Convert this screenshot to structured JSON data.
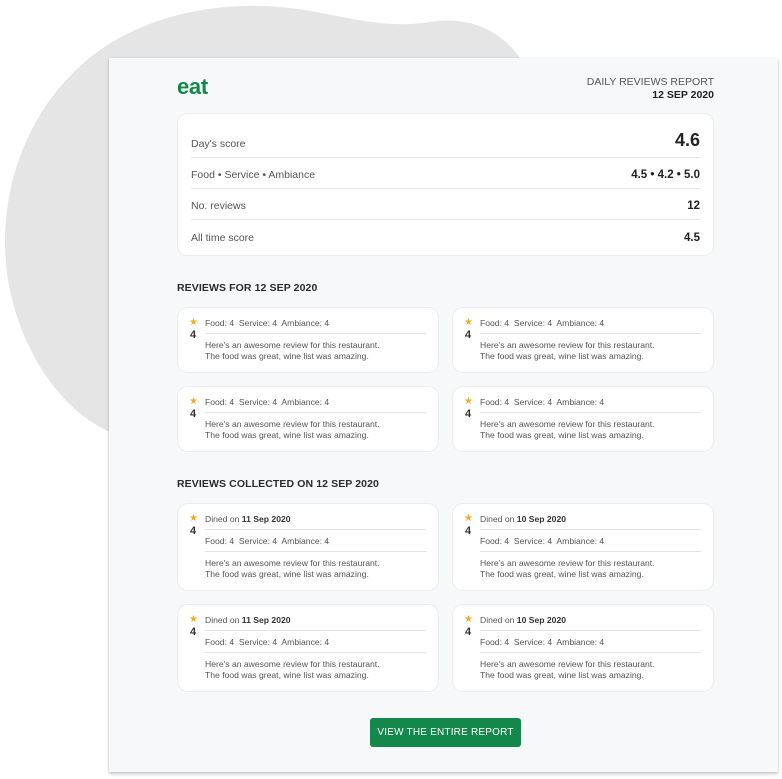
{
  "brand": {
    "logo": "eat",
    "accent_color": "#14884a"
  },
  "report": {
    "title": "DAILY REVIEWS REPORT",
    "date": "12 SEP 2020"
  },
  "summary": [
    {
      "label": "Day's score",
      "value": "4.6"
    },
    {
      "label": "Food • Service • Ambiance",
      "value": "4.5 • 4.2 • 5.0"
    },
    {
      "label": "No. reviews",
      "value": "12"
    },
    {
      "label": "All time score",
      "value": "4.5"
    }
  ],
  "reviews_section": {
    "title": "REVIEWS FOR 12 SEP 2020",
    "items": [
      {
        "rating": "4",
        "scores": "Food: 4  Service: 4  Ambiance: 4",
        "text_line1": "Here's an awesome review for this restaurant.",
        "text_line2": "The food was great, wine list was amazing."
      },
      {
        "rating": "4",
        "scores": "Food: 4  Service: 4  Ambiance: 4",
        "text_line1": "Here's an awesome review for this restaurant.",
        "text_line2": "The food was great, wine list was amazing."
      },
      {
        "rating": "4",
        "scores": "Food: 4  Service: 4  Ambiance: 4",
        "text_line1": "Here's an awesome review for this restaurant.",
        "text_line2": "The food was great, wine list was amazing."
      },
      {
        "rating": "4",
        "scores": "Food: 4  Service: 4  Ambiance: 4",
        "text_line1": "Here's an awesome review for this restaurant.",
        "text_line2": "The food was great, wine list was amazing."
      }
    ]
  },
  "collected_section": {
    "title": "REVIEWS COLLECTED ON 12 SEP 2020",
    "dined_prefix": "Dined on ",
    "items": [
      {
        "rating": "4",
        "dined_date": "11 Sep 2020",
        "scores": "Food: 4  Service: 4  Ambiance: 4",
        "text_line1": "Here's an awesome review for this restaurant.",
        "text_line2": "The food was great, wine list was amazing."
      },
      {
        "rating": "4",
        "dined_date": "10 Sep 2020",
        "scores": "Food: 4  Service: 4  Ambiance: 4",
        "text_line1": "Here's an awesome review for this restaurant.",
        "text_line2": "The food was great, wine list was amazing."
      },
      {
        "rating": "4",
        "dined_date": "11 Sep 2020",
        "scores": "Food: 4  Service: 4  Ambiance: 4",
        "text_line1": "Here's an awesome review for this restaurant.",
        "text_line2": "The food was great, wine list was amazing."
      },
      {
        "rating": "4",
        "dined_date": "10 Sep 2020",
        "scores": "Food: 4  Service: 4  Ambiance: 4",
        "text_line1": "Here's an awesome review for this restaurant.",
        "text_line2": "The food was great, wine list was amazing."
      }
    ]
  },
  "cta": {
    "label": "VIEW THE ENTIRE REPORT"
  },
  "icons": {
    "star": "star-icon"
  },
  "colors": {
    "star": "#f7a928",
    "page_bg": "#f7f8fa",
    "blob": "#e5e5e5"
  }
}
